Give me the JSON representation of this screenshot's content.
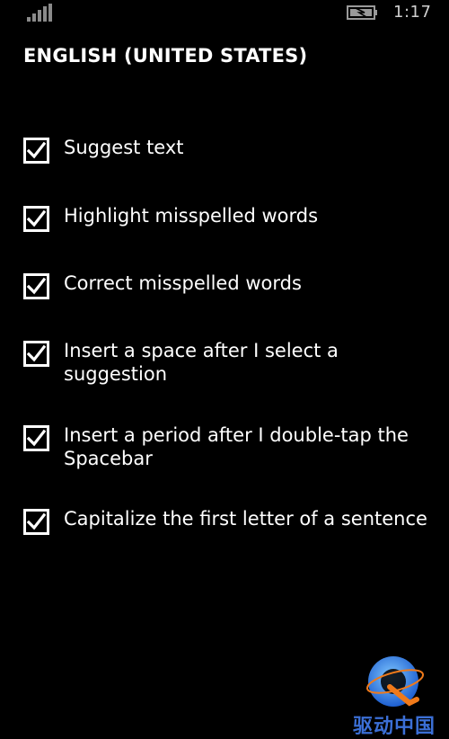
{
  "status_bar": {
    "time": "1:17",
    "signal_icon": "signal-strength-icon",
    "battery_icon": "battery-charging-icon"
  },
  "page": {
    "title": "ENGLISH (UNITED STATES)"
  },
  "options": [
    {
      "label": "Suggest text",
      "checked": true
    },
    {
      "label": "Highlight misspelled words",
      "checked": true
    },
    {
      "label": "Correct misspelled words",
      "checked": true
    },
    {
      "label": "Insert a space after I select a suggestion",
      "checked": true
    },
    {
      "label": "Insert a period after I double-tap the Spacebar",
      "checked": true
    },
    {
      "label": "Capitalize the first letter of a sentence",
      "checked": true
    }
  ],
  "watermark": {
    "text": "驱动中国"
  },
  "colors": {
    "background": "#000000",
    "foreground": "#ffffff",
    "watermark_blue": "#3b6fd6",
    "watermark_orange": "#f07a1a"
  }
}
